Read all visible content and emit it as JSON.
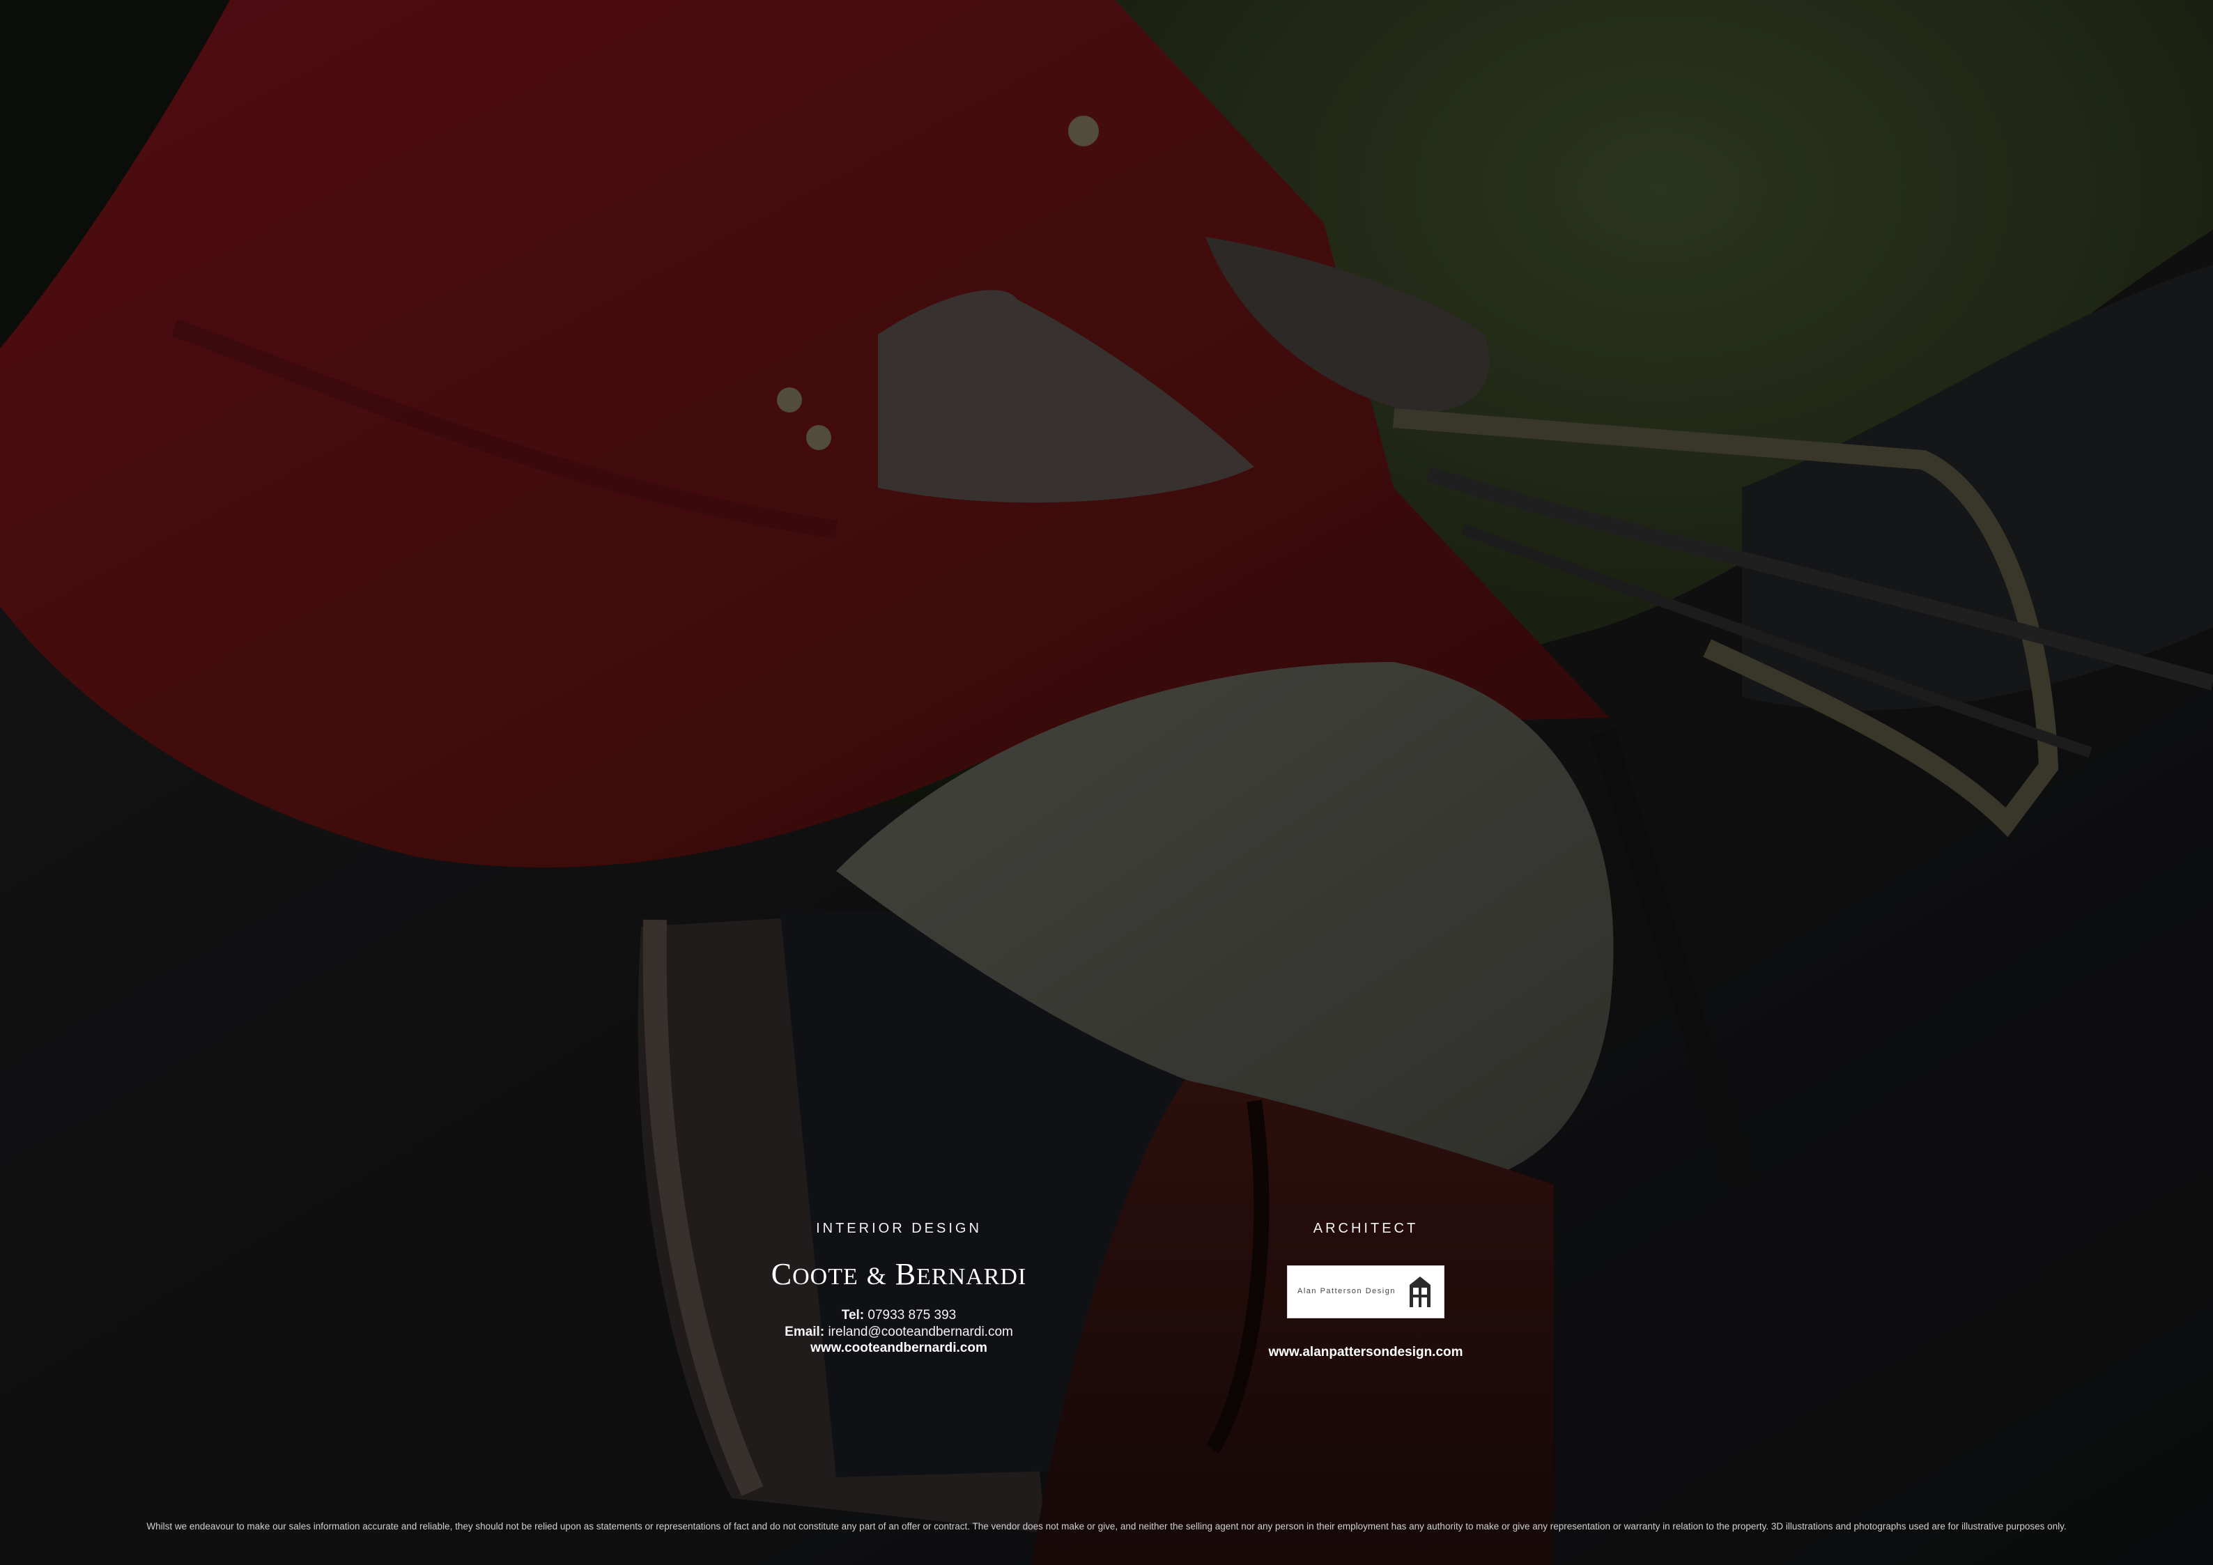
{
  "interior_design": {
    "heading": "INTERIOR DESIGN",
    "brand_first": "C",
    "brand_first_rest": "OOTE",
    "brand_amp": "&",
    "brand_second": "B",
    "brand_second_rest": "ERNARDI",
    "tel_label": "Tel:",
    "tel_value": "07933 875 393",
    "email_label": "Email:",
    "email_value": "ireland@cooteandbernardi.com",
    "website": "www.cooteandbernardi.com"
  },
  "architect": {
    "heading": "ARCHITECT",
    "logo_text": "Alan Patterson Design",
    "website": "www.alanpattersondesign.com"
  },
  "disclaimer": "Whilst we endeavour to make our sales information accurate and reliable, they should not be relied upon as statements or representations of fact and do not constitute any part of an offer or contract. The vendor does not make or give, and neither the selling agent nor any person in their employment has any authority to make or give any representation or warranty in relation to the property. 3D illustrations and photographs used are for illustrative purposes only.",
  "colors": {
    "jacket_red": "#5a0f14",
    "background_dark": "#0b0c0d",
    "text": "#ffffff"
  }
}
